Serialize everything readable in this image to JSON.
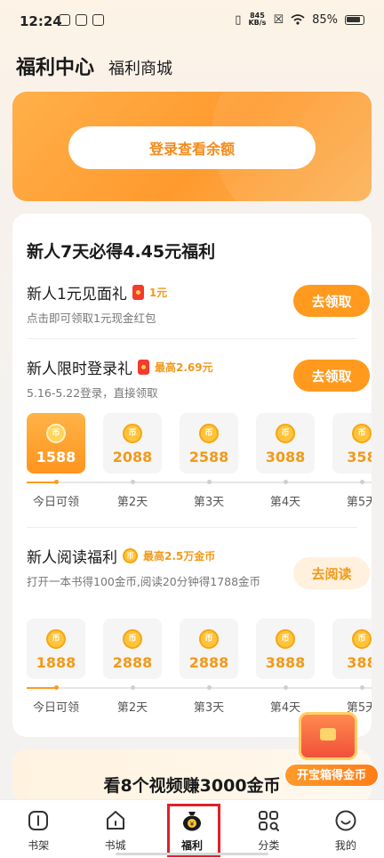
{
  "status_bar": {
    "time": "12:24",
    "net_speed_top": "845",
    "net_speed_bottom": "KB/s",
    "battery": "85%"
  },
  "header": {
    "title": "福利中心",
    "subtitle": "福利商城"
  },
  "login_banner": {
    "button_label": "登录查看余额"
  },
  "welfare": {
    "title": "新人7天必得4.45元福利",
    "task1": {
      "name": "新人1元见面礼",
      "tag": "1元",
      "desc": "点击即可领取1元现金红包",
      "button": "去领取"
    },
    "task2": {
      "name": "新人限时登录礼",
      "tag": "最高2.69元",
      "desc": "5.16-5.22登录，直接领取",
      "button": "去领取",
      "days": [
        {
          "amount": "1588",
          "label": "今日可领"
        },
        {
          "amount": "2088",
          "label": "第2天"
        },
        {
          "amount": "2588",
          "label": "第3天"
        },
        {
          "amount": "3088",
          "label": "第4天"
        },
        {
          "amount": "358",
          "label": "第5天"
        }
      ]
    },
    "task3": {
      "name": "新人阅读福利",
      "tag": "最高2.5万金币",
      "desc": "打开一本书得100金币,阅读20分钟得1788金币",
      "button": "去阅读",
      "days": [
        {
          "amount": "1888",
          "label": "今日可领"
        },
        {
          "amount": "2888",
          "label": "第2天"
        },
        {
          "amount": "2888",
          "label": "第3天"
        },
        {
          "amount": "3888",
          "label": "第4天"
        },
        {
          "amount": "388",
          "label": "第5天"
        }
      ]
    },
    "coin_glyph": "币"
  },
  "video_card": {
    "title": "看8个视频赚3000金币"
  },
  "treasure": {
    "label": "开宝箱得金币"
  },
  "tabs": [
    {
      "label": "书架",
      "icon": "bookshelf-icon"
    },
    {
      "label": "书城",
      "icon": "bookstore-home-icon"
    },
    {
      "label": "福利",
      "icon": "money-bag-icon",
      "active": true
    },
    {
      "label": "分类",
      "icon": "category-grid-icon"
    },
    {
      "label": "我的",
      "icon": "profile-smile-icon"
    }
  ],
  "colors": {
    "accent": "#ff9a1f",
    "gold_text": "#f29a1a",
    "active_tab_frame": "#e0202a"
  }
}
